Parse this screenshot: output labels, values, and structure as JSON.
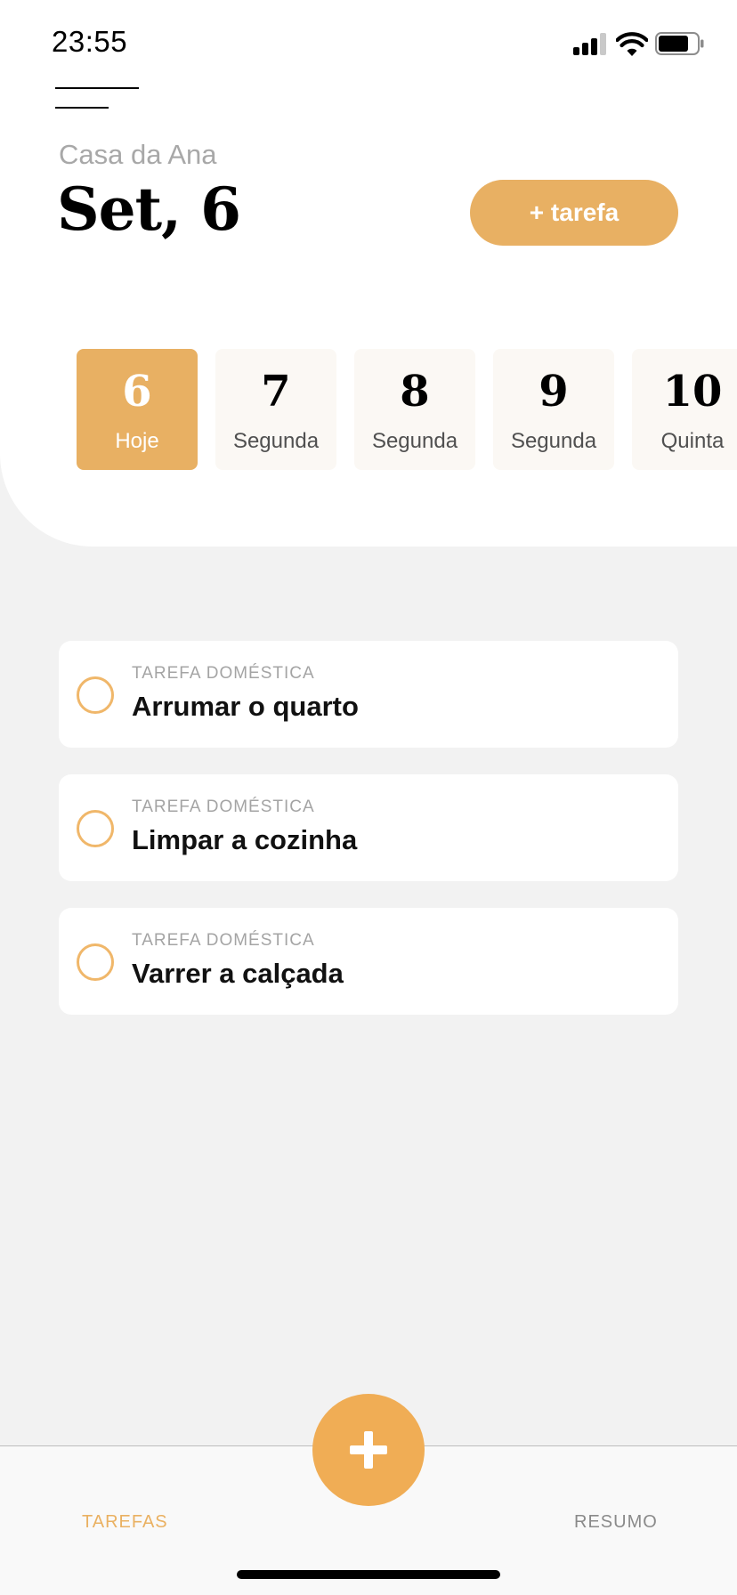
{
  "status_bar": {
    "time": "23:55",
    "icons": [
      "signal-icon",
      "wifi-icon",
      "battery-icon"
    ]
  },
  "header": {
    "menu_icon": "hamburger-menu-icon",
    "house_name": "Casa da Ana",
    "date_title": "Set, 6",
    "add_task_label": "+ tarefa"
  },
  "days": [
    {
      "number": "6",
      "label": "Hoje",
      "active": true
    },
    {
      "number": "7",
      "label": "Segunda",
      "active": false
    },
    {
      "number": "8",
      "label": "Segunda",
      "active": false
    },
    {
      "number": "9",
      "label": "Segunda",
      "active": false
    },
    {
      "number": "10",
      "label": "Quinta",
      "active": false
    }
  ],
  "tasks": [
    {
      "category": "TAREFA DOMÉSTICA",
      "title": "Arrumar o quarto"
    },
    {
      "category": "TAREFA DOMÉSTICA",
      "title": "Limpar a cozinha"
    },
    {
      "category": "TAREFA DOMÉSTICA",
      "title": "Varrer a calçada"
    }
  ],
  "tab_bar": {
    "tab_tasks": "TAREFAS",
    "tab_summary": "RESUMO",
    "fab_icon": "plus-icon"
  },
  "colors": {
    "accent": "#e8b063",
    "fab": "#f0ad55",
    "background": "#f2f2f2"
  }
}
